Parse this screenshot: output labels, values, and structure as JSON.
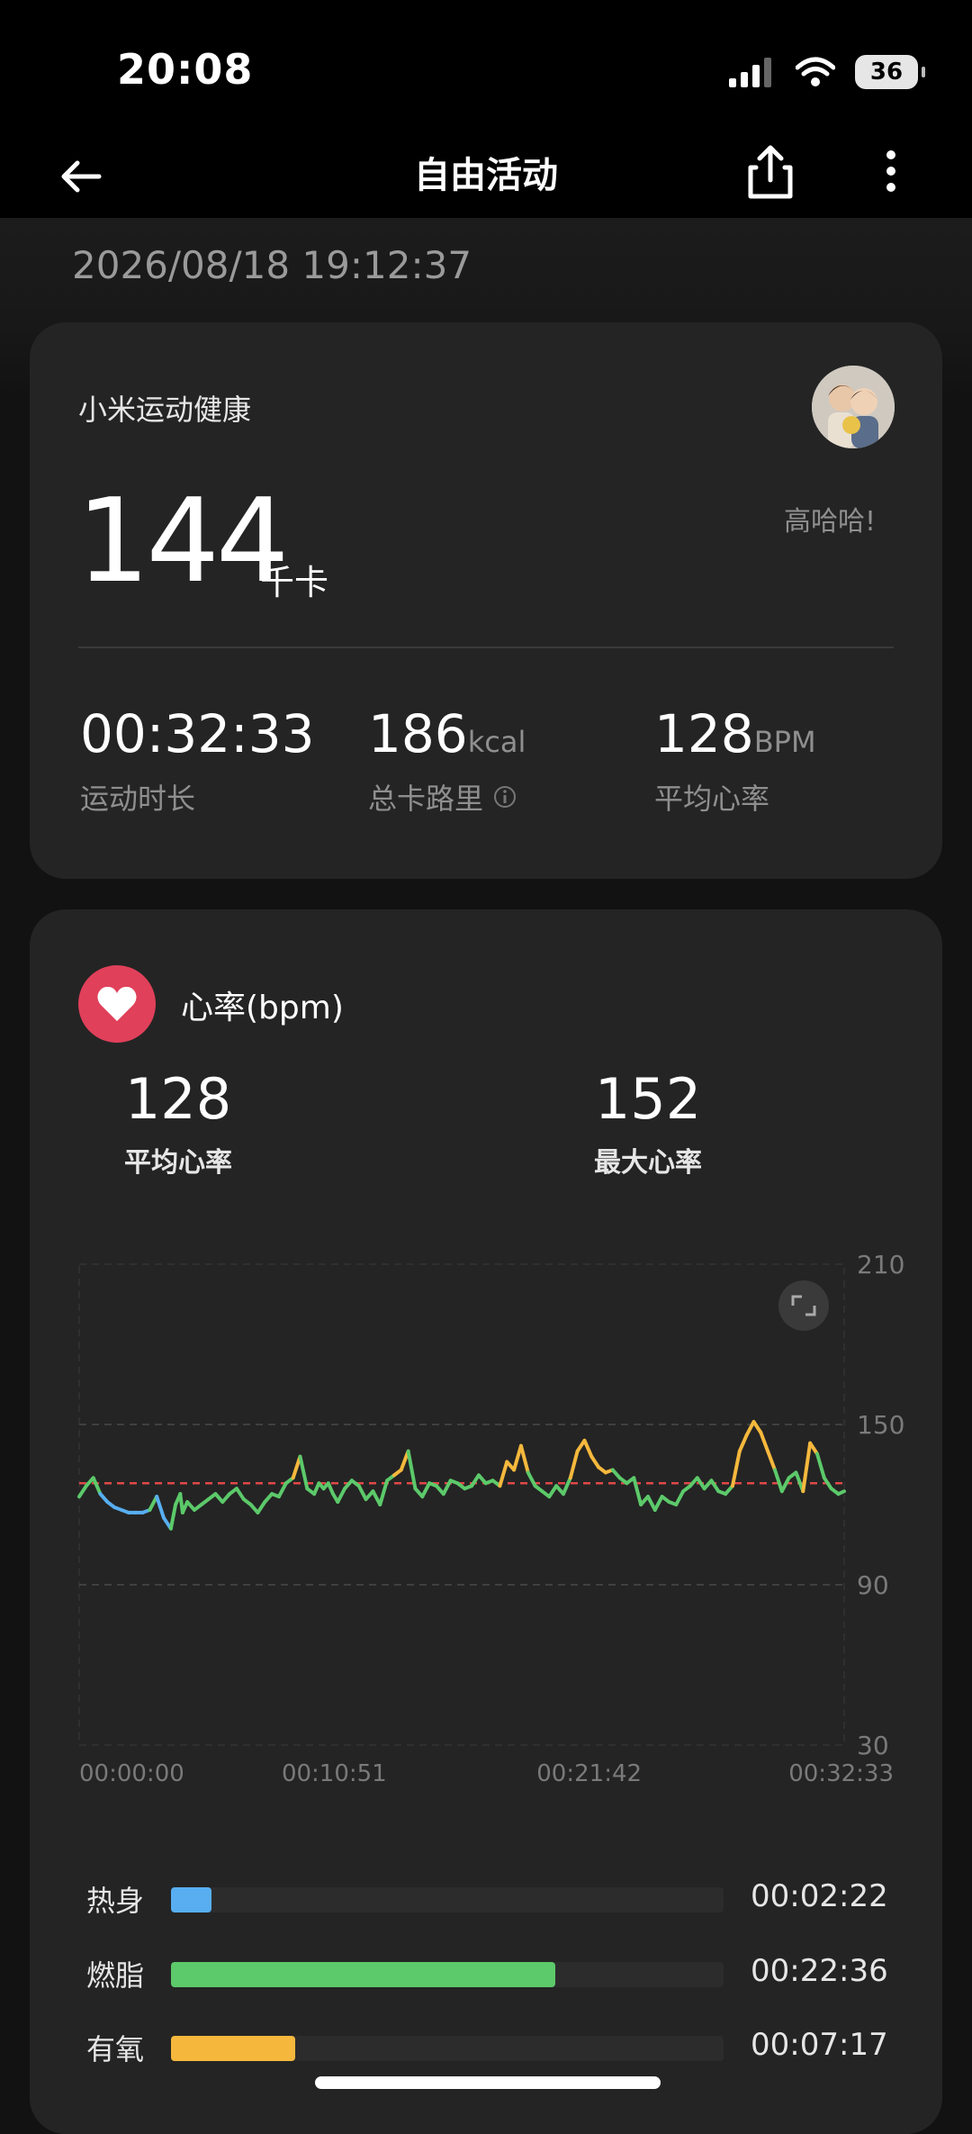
{
  "status_bar": {
    "time": "20:08",
    "battery": "36"
  },
  "nav": {
    "title": "自由活动",
    "back_icon": "arrow-left-icon",
    "share_icon": "share-icon",
    "more_icon": "more-vertical-icon"
  },
  "workout": {
    "datetime": "2026/08/18 19:12:37"
  },
  "summary": {
    "app_name": "小米运动健康",
    "user_name": "高哈哈!",
    "calories": "144",
    "calories_unit": "千卡",
    "stats": [
      {
        "value": "00:32:33",
        "unit": "",
        "label": "运动时长"
      },
      {
        "value": "186",
        "unit": "kcal",
        "label": "总卡路里"
      },
      {
        "value": "128",
        "unit": "BPM",
        "label": "平均心率"
      }
    ]
  },
  "heart_rate": {
    "title": "心率(bpm)",
    "avg_value": "128",
    "avg_label": "平均心率",
    "max_value": "152",
    "max_label": "最大心率"
  },
  "chart_data": {
    "type": "line",
    "title": "心率(bpm)",
    "xlabel": "",
    "ylabel": "",
    "x_ticks": [
      "00:00:00",
      "00:10:51",
      "00:21:42",
      "00:32:33"
    ],
    "y_ticks": [
      "210",
      "150",
      "90",
      "30"
    ],
    "ylim": [
      30,
      210
    ],
    "xlim_minutes": [
      0,
      32.55
    ],
    "grid": true,
    "reference_line": {
      "value": 128,
      "color": "#e04848"
    },
    "zone_colors": {
      "warmup": "#58aef0",
      "fat_burn": "#5cc96a",
      "aerobic": "#f5b83d"
    },
    "series": [
      {
        "x": [
          0,
          0.3,
          0.6,
          0.9,
          1.2,
          1.5,
          1.8,
          2.1,
          2.4,
          2.7,
          3.0,
          3.3,
          3.6,
          3.9,
          4.1,
          4.3,
          4.4,
          4.6,
          4.9,
          5.2,
          5.5,
          5.8,
          6.1,
          6.4,
          6.7,
          7.0,
          7.3,
          7.6,
          7.9,
          8.2,
          8.5,
          8.8,
          9.1,
          9.4,
          9.7,
          10.0,
          10.2,
          10.4,
          10.6,
          10.8,
          11.0,
          11.3,
          11.6,
          11.9,
          12.2,
          12.5,
          12.8,
          13.1,
          13.4,
          13.7,
          14.0,
          14.3,
          14.6,
          14.9,
          15.2,
          15.5,
          15.8,
          16.1,
          16.4,
          16.7,
          17.0,
          17.3,
          17.6,
          17.9,
          18.2,
          18.5,
          18.8,
          19.1,
          19.4,
          19.7,
          20.0,
          20.3,
          20.6,
          20.9,
          21.2,
          21.5,
          21.8,
          22.1,
          22.4,
          22.7,
          23.0,
          23.3,
          23.6,
          23.9,
          24.2,
          24.5,
          24.8,
          25.1,
          25.4,
          25.7,
          26.0,
          26.3,
          26.6,
          26.9,
          27.2,
          27.5,
          27.8,
          28.1,
          28.4,
          28.7,
          29.0,
          29.3,
          29.6,
          29.9,
          30.2,
          30.5,
          30.8,
          31.1,
          31.4,
          31.7,
          32.0,
          32.3,
          32.55
        ],
        "y": [
          123,
          127,
          130,
          124,
          121,
          119,
          118,
          117,
          117,
          117,
          118,
          123,
          115,
          111,
          120,
          124,
          117,
          121,
          118,
          120,
          122,
          124,
          121,
          124,
          126,
          122,
          120,
          117,
          121,
          124,
          123,
          128,
          130,
          138,
          126,
          124,
          128,
          126,
          128,
          124,
          121,
          126,
          129,
          127,
          122,
          125,
          120,
          129,
          131,
          133,
          140,
          126,
          123,
          128,
          127,
          124,
          129,
          128,
          126,
          127,
          131,
          128,
          129,
          127,
          136,
          133,
          142,
          132,
          127,
          125,
          123,
          127,
          124,
          130,
          140,
          144,
          138,
          134,
          132,
          133,
          130,
          128,
          130,
          120,
          123,
          118,
          123,
          121,
          120,
          125,
          127,
          130,
          126,
          129,
          125,
          124,
          127,
          140,
          146,
          151,
          147,
          140,
          133,
          125,
          130,
          132,
          125,
          143,
          139,
          130,
          126,
          124,
          125
        ],
        "zone": [
          "fat_burn",
          "fat_burn",
          "fat_burn",
          "fat_burn",
          "warmup",
          "warmup",
          "warmup",
          "warmup",
          "warmup",
          "warmup",
          "warmup",
          "fat_burn",
          "warmup",
          "warmup",
          "fat_burn",
          "fat_burn",
          "fat_burn",
          "fat_burn",
          "fat_burn",
          "fat_burn",
          "fat_burn",
          "fat_burn",
          "fat_burn",
          "fat_burn",
          "fat_burn",
          "fat_burn",
          "fat_burn",
          "fat_burn",
          "fat_burn",
          "fat_burn",
          "fat_burn",
          "fat_burn",
          "fat_burn",
          "aerobic",
          "fat_burn",
          "fat_burn",
          "fat_burn",
          "fat_burn",
          "fat_burn",
          "fat_burn",
          "fat_burn",
          "fat_burn",
          "fat_burn",
          "fat_burn",
          "fat_burn",
          "fat_burn",
          "fat_burn",
          "fat_burn",
          "fat_burn",
          "aerobic",
          "aerobic",
          "fat_burn",
          "fat_burn",
          "fat_burn",
          "fat_burn",
          "fat_burn",
          "fat_burn",
          "fat_burn",
          "fat_burn",
          "fat_burn",
          "fat_burn",
          "fat_burn",
          "fat_burn",
          "fat_burn",
          "aerobic",
          "aerobic",
          "aerobic",
          "aerobic",
          "fat_burn",
          "fat_burn",
          "fat_burn",
          "fat_burn",
          "fat_burn",
          "fat_burn",
          "aerobic",
          "aerobic",
          "aerobic",
          "aerobic",
          "aerobic",
          "aerobic",
          "fat_burn",
          "fat_burn",
          "fat_burn",
          "fat_burn",
          "fat_burn",
          "fat_burn",
          "fat_burn",
          "fat_burn",
          "fat_burn",
          "fat_burn",
          "fat_burn",
          "fat_burn",
          "fat_burn",
          "fat_burn",
          "fat_burn",
          "fat_burn",
          "fat_burn",
          "aerobic",
          "aerobic",
          "aerobic",
          "aerobic",
          "aerobic",
          "aerobic",
          "fat_burn",
          "fat_burn",
          "fat_burn",
          "fat_burn",
          "aerobic",
          "aerobic",
          "fat_burn",
          "fat_burn",
          "fat_burn",
          "fat_burn"
        ]
      }
    ]
  },
  "zones": [
    {
      "label": "热身",
      "time": "00:02:22",
      "fraction": 0.073,
      "color": "#58aef0"
    },
    {
      "label": "燃脂",
      "time": "00:22:36",
      "fraction": 0.695,
      "color": "#5cc96a"
    },
    {
      "label": "有氧",
      "time": "00:07:17",
      "fraction": 0.224,
      "color": "#f5b83d"
    }
  ]
}
